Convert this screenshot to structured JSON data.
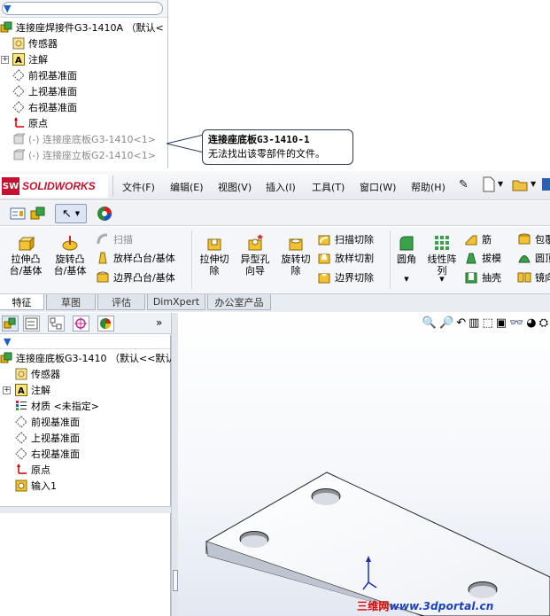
{
  "top_tree": {
    "root": "连接座焊接件G3-1410A （默认<",
    "items": [
      "传感器",
      "注解",
      "前视基准面",
      "上视基准面",
      "右视基准面",
      "原点"
    ],
    "gray_items": [
      "(-) 连接座底板G3-1410<1>",
      "(-) 连接座立板G2-1410<1>"
    ]
  },
  "callout": {
    "title": "连接座底板G3-1410-1",
    "message": "无法找出该零部件的文件。"
  },
  "app": {
    "logo_text": "SOLIDWORKS",
    "logo_badge": "SW",
    "menus": [
      "文件(F)",
      "编辑(E)",
      "视图(V)",
      "插入(I)",
      "工具(T)",
      "窗口(W)",
      "帮助(H)"
    ]
  },
  "ribbon": {
    "extrude_boss": "拉伸凸\n台/基体",
    "revolve_boss": "旋转凸\n台/基体",
    "sweep": "扫描",
    "loft_boss": "放样凸台/基体",
    "boundary_boss": "边界凸台/基体",
    "extrude_cut": "拉伸切\n除",
    "hole_wizard": "异型孔\n向导",
    "revolve_cut": "旋转切\n除",
    "sweep_cut": "扫描切除",
    "loft_cut": "放样切割",
    "boundary_cut": "边界切除",
    "fillet": "圆角",
    "linear_pattern": "线性阵\n列",
    "rib": "筋",
    "draft": "拔模",
    "shell": "抽壳",
    "wrap": "包覆",
    "dome": "圆顶",
    "mirror": "镜向"
  },
  "tabs": [
    "特征",
    "草图",
    "评估",
    "DimXpert",
    "办公室产品"
  ],
  "feature_tree": {
    "root": "连接座底板G3-1410 （默认<<默认",
    "items": [
      "传感器",
      "注解",
      "材质 <未指定>",
      "前视基准面",
      "上视基准面",
      "右视基准面",
      "原点",
      "输入1"
    ]
  },
  "watermark": {
    "part1": "三维网",
    "part2": "www.3dportal.cn"
  },
  "colors": {
    "brand_red": "#c8102e",
    "accent_blue": "#2060c0",
    "tree_gray": "#8a8a8a",
    "watermark_red": "#e00000",
    "watermark_blue": "#1a3fbf"
  }
}
